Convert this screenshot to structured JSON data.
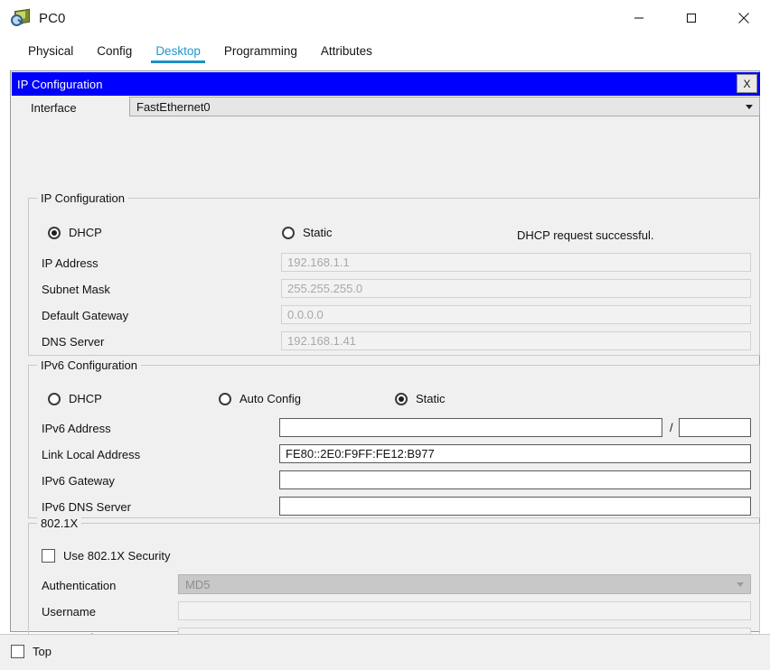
{
  "window": {
    "title": "PC0",
    "icon": "pc-device-icon",
    "controls": {
      "minimize": "minimize-icon",
      "maximize": "maximize-icon",
      "close": "close-icon"
    }
  },
  "tabs": [
    {
      "label": "Physical",
      "active": false
    },
    {
      "label": "Config",
      "active": false
    },
    {
      "label": "Desktop",
      "active": true
    },
    {
      "label": "Programming",
      "active": false
    },
    {
      "label": "Attributes",
      "active": false
    }
  ],
  "dialog": {
    "title": "IP Configuration",
    "close_label": "X",
    "title_bg": "#0000ff",
    "title_fg": "#ffffff"
  },
  "interface": {
    "label": "Interface",
    "value": "FastEthernet0",
    "arrow_icon": "chevron-down-icon"
  },
  "ipv4": {
    "group_title": "IP Configuration",
    "mode": {
      "dhcp": {
        "label": "DHCP",
        "checked": true
      },
      "static": {
        "label": "Static",
        "checked": false
      }
    },
    "status": "DHCP request successful.",
    "fields": [
      {
        "label": "IP Address",
        "value": "192.168.1.1",
        "disabled": true
      },
      {
        "label": "Subnet Mask",
        "value": "255.255.255.0",
        "disabled": true
      },
      {
        "label": "Default Gateway",
        "value": "0.0.0.0",
        "disabled": true
      },
      {
        "label": "DNS Server",
        "value": "192.168.1.41",
        "disabled": true
      }
    ]
  },
  "ipv6": {
    "group_title": "IPv6 Configuration",
    "mode": {
      "dhcp": {
        "label": "DHCP",
        "checked": false
      },
      "auto_config": {
        "label": "Auto Config",
        "checked": false
      },
      "static": {
        "label": "Static",
        "checked": true
      }
    },
    "address": {
      "label": "IPv6 Address",
      "value": "",
      "separator": "/",
      "prefix_value": ""
    },
    "fields": [
      {
        "label": "Link Local Address",
        "value": "FE80::2E0:F9FF:FE12:B977"
      },
      {
        "label": "IPv6 Gateway",
        "value": ""
      },
      {
        "label": "IPv6 DNS Server",
        "value": ""
      }
    ]
  },
  "dot1x": {
    "group_title": "802.1X",
    "use_security": {
      "label": "Use 802.1X Security",
      "checked": false
    },
    "authentication": {
      "label": "Authentication",
      "value": "MD5",
      "disabled": true,
      "arrow_icon": "chevron-down-icon"
    },
    "username": {
      "label": "Username",
      "value": ""
    },
    "password": {
      "label": "Password",
      "value": ""
    }
  },
  "footer": {
    "top_checkbox": {
      "label": "Top",
      "checked": false
    }
  }
}
